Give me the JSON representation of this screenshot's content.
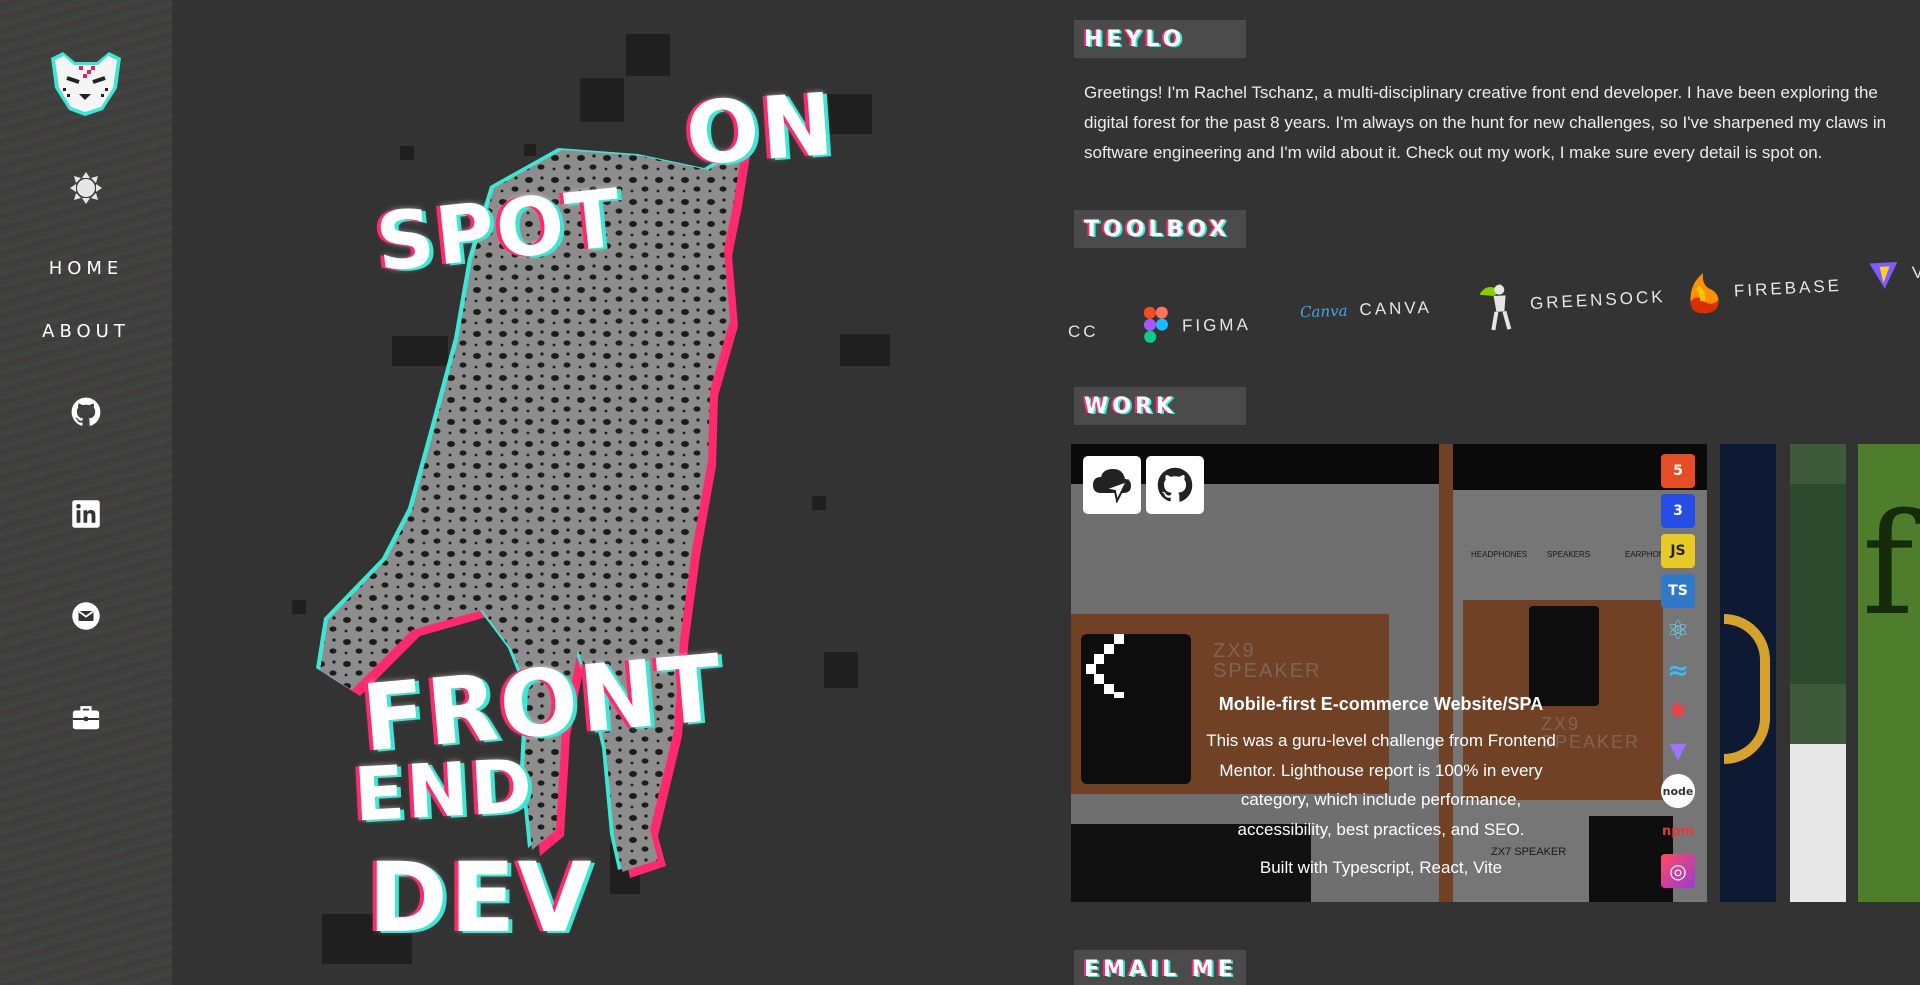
{
  "sidebar": {
    "logo_alt": "cheetah-logo",
    "theme_toggle": "sun-icon",
    "nav": [
      {
        "label": "HOME"
      },
      {
        "label": "ABOUT"
      }
    ],
    "social": [
      "github-icon",
      "linkedin-icon",
      "email-icon",
      "briefcase-icon"
    ]
  },
  "hero": {
    "line1a": "SPOT",
    "line1b": "ON",
    "line2": "FRONT",
    "line3": "END",
    "line4": "DEV"
  },
  "about": {
    "heading": "HEYLO",
    "bio": "Greetings! I'm Rachel Tschanz, a multi-disciplinary creative front end developer. I have been exploring the digital forest for the past 8 years. I'm always on the hunt for new challenges, so I've sharpened my claws in software engineering and I'm wild about it. Check out my work, I make sure every detail is spot on."
  },
  "toolbox": {
    "heading": "TOOLBOX",
    "items": [
      {
        "name": "CC",
        "icon": "creative-cloud-icon"
      },
      {
        "name": "FIGMA",
        "icon": "figma-icon"
      },
      {
        "name": "CANVA",
        "icon": "canva-icon",
        "logo_text": "Canva"
      },
      {
        "name": "GREENSOCK",
        "icon": "greensock-icon"
      },
      {
        "name": "FIREBASE",
        "icon": "firebase-icon"
      },
      {
        "name": "V",
        "icon": "vite-icon"
      }
    ]
  },
  "work": {
    "heading": "WORK",
    "project": {
      "title": "Mobile-first E-commerce Website/SPA",
      "description": "This was a guru-level challenge from Frontend Mentor. Lighthouse report is 100% in every category, which include performance, accessibility, best practices, and SEO.",
      "built_with": "Built with Typescript, React, Vite",
      "mock_labels": {
        "speaker_a": "ZX9",
        "speaker_b": "SPEAKER",
        "speaker_c": "ZX9",
        "speaker_d": "SPEAKER",
        "speaker_e": "ZX7 SPEAKER",
        "cat1": "HEADPHONES",
        "cat2": "SPEAKERS",
        "cat3": "EARPHONES"
      },
      "tech": [
        {
          "label": "5",
          "icon": "html5-icon",
          "color": "#e44d26"
        },
        {
          "label": "3",
          "icon": "css3-icon",
          "color": "#264de4"
        },
        {
          "label": "JS",
          "icon": "javascript-icon",
          "color": "#e8c927"
        },
        {
          "label": "TS",
          "icon": "typescript-icon",
          "color": "#3178c6"
        },
        {
          "label": "⚛",
          "icon": "react-icon",
          "color": "#2a2a2a"
        },
        {
          "label": "≈",
          "icon": "tailwind-icon",
          "color": "#2a2a2a"
        },
        {
          "label": "✱",
          "icon": "rollup-icon",
          "color": "#2a2a2a"
        },
        {
          "label": "▼",
          "icon": "vite-icon",
          "color": "#2a2a2a"
        },
        {
          "label": "node",
          "icon": "node-icon",
          "color": "#ffffff"
        },
        {
          "label": "npm",
          "icon": "npm-icon",
          "color": "#2a2a2a"
        },
        {
          "label": "◎",
          "icon": "adobe-cc-icon",
          "color": "#e8334a"
        }
      ]
    }
  },
  "contact": {
    "heading": "EMAIL ME"
  },
  "colors": {
    "background": "#333333",
    "accent_pink": "#ff2a6d",
    "accent_cyan": "#3ee6d4"
  }
}
